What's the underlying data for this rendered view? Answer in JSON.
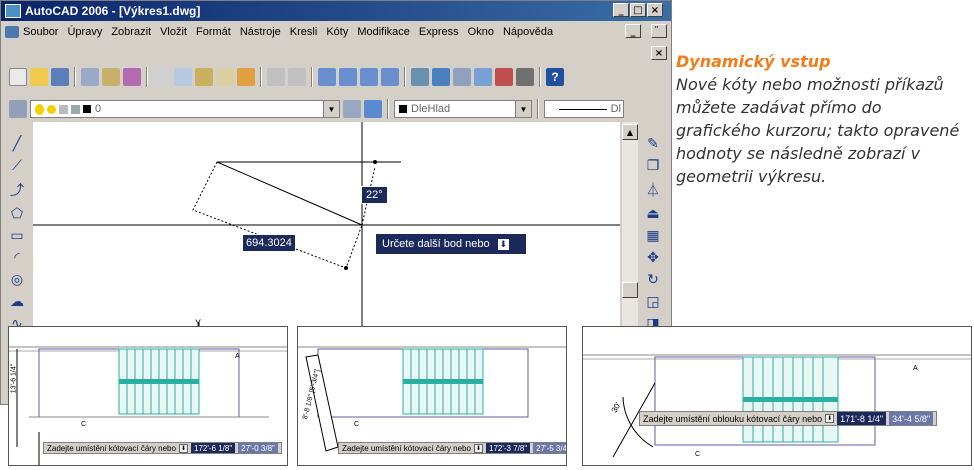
{
  "window": {
    "title": "AutoCAD 2006 - [Výkres1.dwg]",
    "title_buttons": [
      "_",
      "□",
      "×"
    ],
    "doc_buttons": [
      "_",
      "̈",
      "×"
    ]
  },
  "menu": [
    "Soubor",
    "Úpravy",
    "Zobrazit",
    "Vložit",
    "Formát",
    "Nástroje",
    "Kresli",
    "Kóty",
    "Modifikace",
    "Express",
    "Okno",
    "Nápověda"
  ],
  "layers": {
    "layer_value": "0",
    "color_value": "DleHlad",
    "linetype_value": "Dl"
  },
  "canvas": {
    "angle_value": "22°",
    "length_value": "694.3024",
    "prompt": "Určete další bod nebo",
    "dropdown_glyph": "⬇",
    "ucs_label": "Y"
  },
  "side": {
    "heading": "Dynamický vstup",
    "body": "Nové kóty nebo možnosti příkazů můžete zadávat přímo do grafického kurzoru; takto opravené hodnoty se následně zobrazí v geometrii výkresu."
  },
  "thumbs": [
    {
      "label_a": "A",
      "label_c": "C",
      "vert_dim": "13'-6 1/4\"",
      "prompt": "Zadejte umístění kótovací čáry nebo",
      "v1": "172'-6 1/8\"",
      "v2": "27'-0 3/8\""
    },
    {
      "label_c": "C",
      "vert_dim": "8'-8 1/8\" [5'-3/4\"]",
      "prompt": "Zadejte umístění kótovací čáry nebo",
      "v1": "172'-3 7/8\"",
      "v2": "27'-5 3/4\""
    },
    {
      "label_a": "A",
      "label_c": "C",
      "arc_dim": "30'",
      "prompt": "Zadejte umístění oblouku kótovací čáry nebo",
      "v1": "171'-8 1/4\"",
      "v2": "34'-4 5/8\""
    }
  ],
  "colors": {
    "accent": "#f07d1a",
    "titlebar": "#0a246a",
    "teal": "#2ab0a0"
  }
}
